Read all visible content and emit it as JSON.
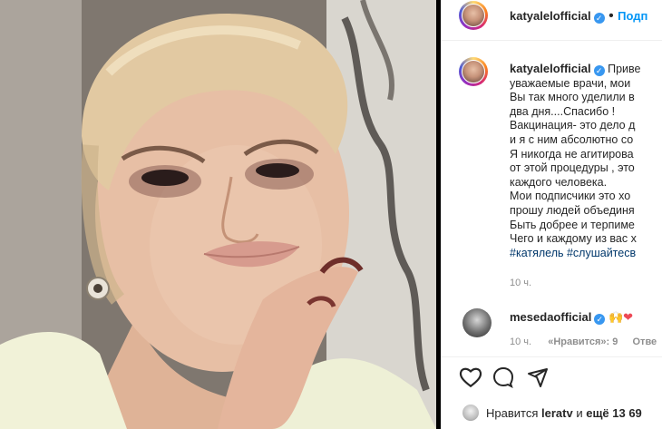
{
  "post": {
    "username": "katyalelofficial",
    "follow_label": "Подп",
    "caption_lines": [
      "Приве",
      "уважаемые врачи, мои",
      "Вы так много уделили в",
      "два дня....Спасибо !",
      "Вакцинация- это дело д",
      "и я с ним абсолютно со",
      "Я никогда не агитирова",
      "от этой процедуры , это",
      "каждого человека.",
      "Мои подписчики это хо",
      "прошу людей объединя",
      "Быть добрее и терпиме",
      "Чего и каждому из вас х"
    ],
    "hashtags": "#катялель #слушайтесв",
    "time": "10 ч."
  },
  "comment": {
    "username": "mesedaofficial",
    "emoji": "🙌❤",
    "time": "10 ч.",
    "likes": "«Нравится»: 9",
    "reply_label": "Отве"
  },
  "likes_row": {
    "prefix": "Нравится",
    "user": "leratv",
    "middle": "и",
    "rest": "ещё 13 69"
  },
  "icons": [
    "verified-badge-icon",
    "heart-icon",
    "comment-icon",
    "share-icon"
  ],
  "colors": {
    "accent": "#0095f6",
    "verified": "#3897f0",
    "heart": "#ed4956"
  }
}
